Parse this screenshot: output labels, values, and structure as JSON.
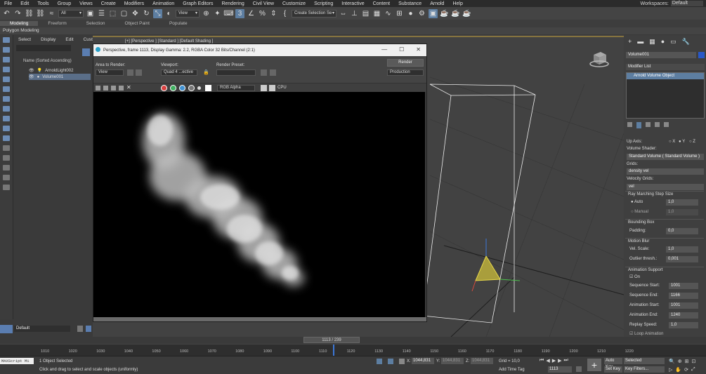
{
  "menubar": {
    "items": [
      "File",
      "Edit",
      "Tools",
      "Group",
      "Views",
      "Create",
      "Modifiers",
      "Animation",
      "Graph Editors",
      "Rendering",
      "Civil View",
      "Customize",
      "Scripting",
      "Interactive",
      "Content",
      "Substance",
      "Arnold",
      "Help"
    ],
    "workspaces_label": "Workspaces:",
    "workspaces_value": "Default"
  },
  "toolbar": {
    "filter": "All",
    "view": "View",
    "selection_set": "Create Selection Se"
  },
  "ribbon": {
    "tabs": [
      "Modeling",
      "Freeform",
      "Selection",
      "Object Paint",
      "Populate"
    ],
    "active": "Modeling",
    "sub": "Polygon Modeling"
  },
  "explorer": {
    "menu": [
      "Select",
      "Display",
      "Edit",
      "Customize"
    ],
    "header": "Name (Sorted Ascending)",
    "items": [
      "ArnoldLight002",
      "Volume001"
    ],
    "selected": "Volume001",
    "layer": "Default"
  },
  "viewport": {
    "label": "[+] [Perspective ] [Standard ] [Default Shading ]"
  },
  "render_window": {
    "title": "Perspective, frame 1113, Display Gamma: 2.2, RGBA Color 32 Bits/Channel (2:1)",
    "area_label": "Area to Render:",
    "area_value": "View",
    "viewport_label": "Viewport:",
    "viewport_value": "Quad 4 ...ective",
    "preset_label": "Render Preset:",
    "preset_value": "",
    "render_button": "Render",
    "production": "Production",
    "channel": "RGB Alpha",
    "cpu": "CPU"
  },
  "command_panel": {
    "object_name": "Volume001",
    "modifier_list": "Modifier List",
    "stack_item": "Arnold Volume Object",
    "up_axis_label": "Up Axis:",
    "axes": [
      "X",
      "Y",
      "Z"
    ],
    "up_axis_selected": "Y",
    "volume_shader_label": "Volume Shader:",
    "volume_shader_value": "Standard Volume  ( Standard Volume )",
    "grids_label": "Grids:",
    "grids_value": "density vel",
    "velocity_grids_label": "Velocity Grids:",
    "velocity_grids_value": "vel",
    "ray_marching_label": "Ray Marching Step Size",
    "auto_label": "Auto",
    "auto_value": "1,0",
    "manual_label": "Manual",
    "manual_value": "1,0",
    "bounding_box_label": "Bounding Box",
    "padding_label": "Padding:",
    "padding_value": "0,0",
    "motion_blur_label": "Motion Blur",
    "vel_scale_label": "Vel. Scale:",
    "vel_scale_value": "1,0",
    "outlier_label": "Outlier thresh.:",
    "outlier_value": "0,001",
    "anim_support_label": "Animation Support",
    "on_label": "On",
    "seq_start_label": "Sequence Start:",
    "seq_start_value": "1001",
    "seq_end_label": "Sequence End:",
    "seq_end_value": "1166",
    "anim_start_label": "Animation Start:",
    "anim_start_value": "1001",
    "anim_end_label": "Animation End:",
    "anim_end_value": "1240",
    "replay_label": "Replay Speed:",
    "replay_value": "1,0",
    "loop_label": "Loop Animation"
  },
  "timeline": {
    "frame": "1113 / 239",
    "ticks": [
      "1010",
      "1020",
      "1030",
      "1040",
      "1050",
      "1060",
      "1070",
      "1080",
      "1090",
      "1100",
      "1110",
      "1120",
      "1130",
      "1140",
      "1150",
      "1160",
      "1170",
      "1180",
      "1190",
      "1200",
      "1210",
      "1220"
    ]
  },
  "status": {
    "maxscript": "MAXScript Mi",
    "selected": "1 Object Selected",
    "hint": "Click and drag to select and scale objects (uniformly)",
    "x_label": "X:",
    "x_value": "1044,831",
    "y_label": "Y:",
    "y_value": "1044,831",
    "z_label": "Z:",
    "z_value": "1044,831",
    "grid": "Grid = 10,0",
    "add_time_tag": "Add Time Tag",
    "frame_field": "1113",
    "auto_key": "Auto Key",
    "set_key": "Set Key",
    "selected_dd": "Selected",
    "key_filters": "Key Filters..."
  },
  "colors": {
    "accent": "#5d7ea1",
    "selection": "#5a6e88",
    "gizmo": "#d6c63a"
  }
}
